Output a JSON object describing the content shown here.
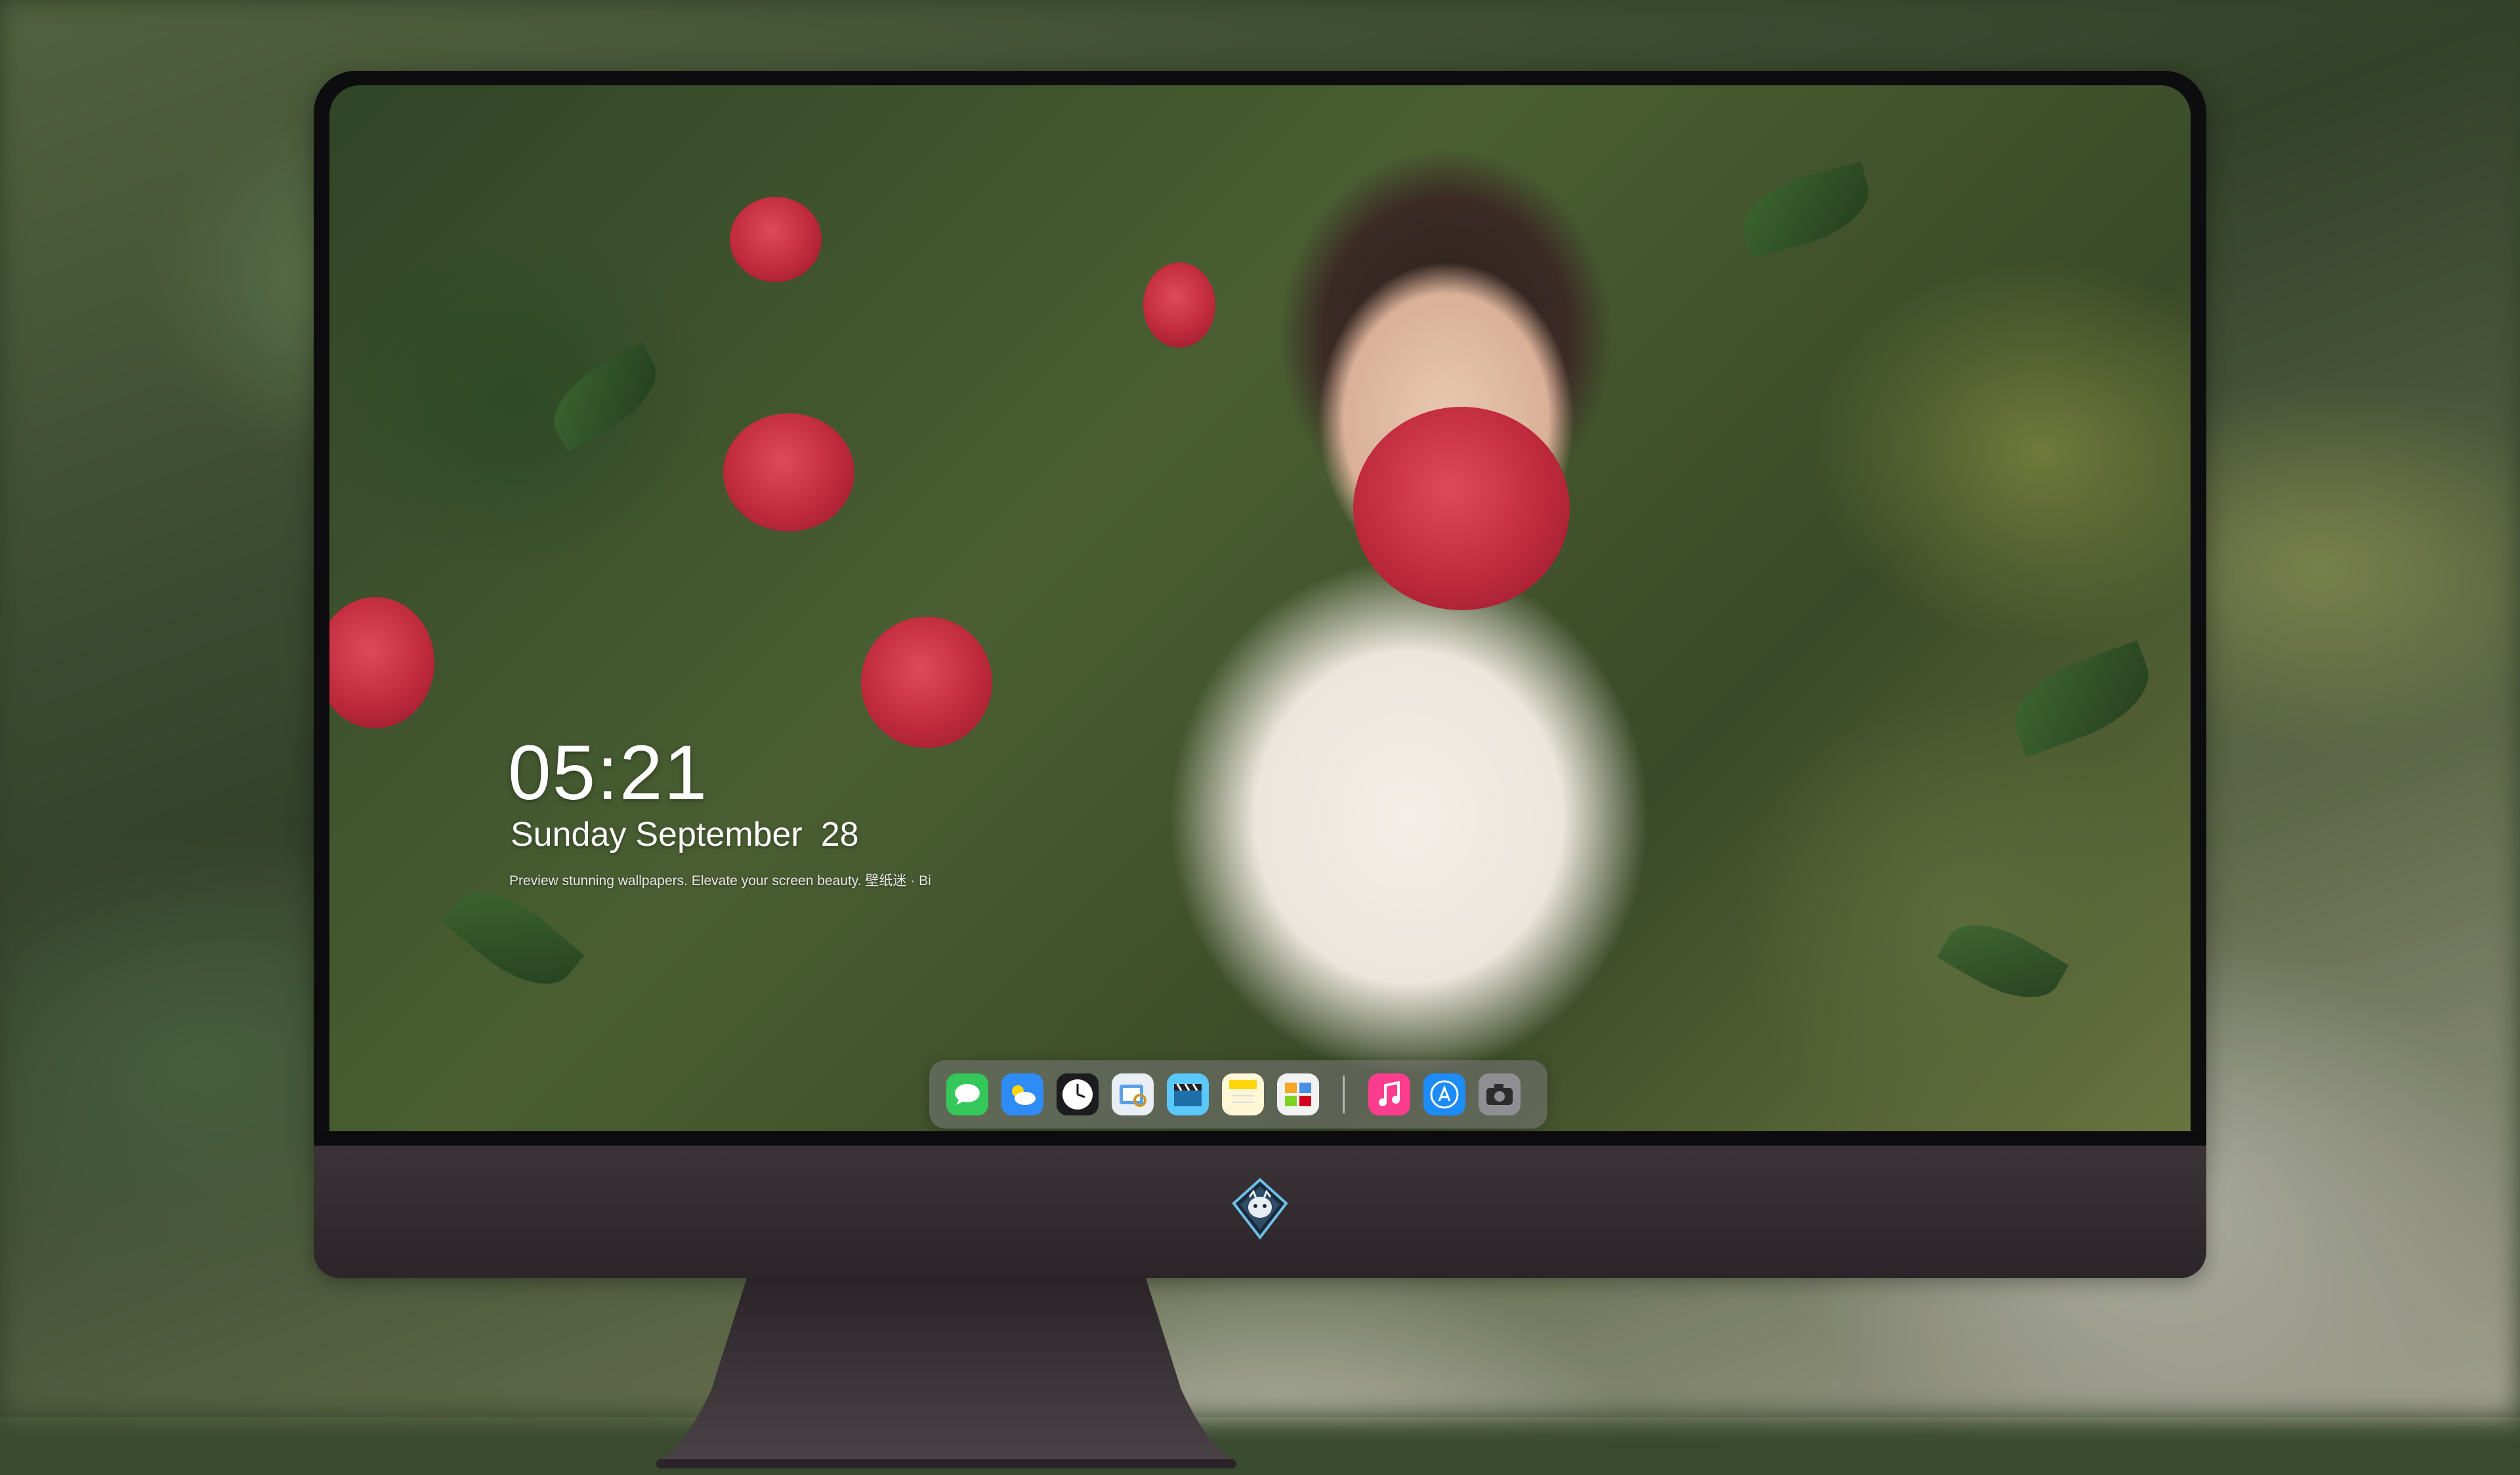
{
  "lockscreen": {
    "time": "05:21",
    "weekday": "Sunday",
    "month": "September",
    "day": "28",
    "tagline": "Preview stunning wallpapers. Elevate your screen beauty. 壁纸迷 · Bi"
  },
  "dock": {
    "apps": [
      {
        "name": "messages-icon",
        "color": "#34c759"
      },
      {
        "name": "weather-icon",
        "color": "#2f8cf5"
      },
      {
        "name": "clock-icon",
        "color": "#1c1c1e"
      },
      {
        "name": "preview-icon",
        "color": "#e9eef5"
      },
      {
        "name": "clips-icon",
        "color": "#5ac8fa"
      },
      {
        "name": "notes-icon",
        "color": "#ffd60a"
      },
      {
        "name": "photo-booth-icon",
        "color": "#f2f2f2"
      },
      {
        "name": "music-icon",
        "color": "#fc3c8d"
      },
      {
        "name": "app-store-icon",
        "color": "#1d8cf8"
      },
      {
        "name": "camera-icon",
        "color": "#8e8e93"
      }
    ]
  },
  "monitor": {
    "logo": "dragon-badge-icon"
  }
}
